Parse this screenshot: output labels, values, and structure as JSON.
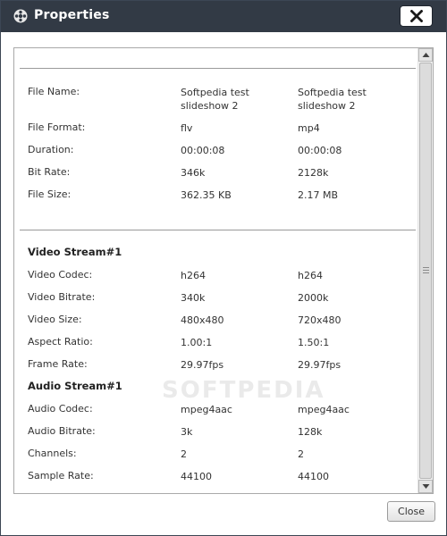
{
  "window": {
    "title": "Properties",
    "title_icon": "film-reel-icon",
    "close_icon": "close-icon",
    "titlebar_color": "#323a45"
  },
  "general": {
    "file_name": {
      "label": "File Name:",
      "v1_line1": "Softpedia test",
      "v1_line2": "slideshow 2",
      "v2_line1": "Softpedia test",
      "v2_line2": "slideshow 2"
    },
    "file_format": {
      "label": "File Format:",
      "v1": "flv",
      "v2": "mp4"
    },
    "duration": {
      "label": "Duration:",
      "v1": "00:00:08",
      "v2": "00:00:08"
    },
    "bit_rate": {
      "label": "Bit Rate:",
      "v1": "346k",
      "v2": "2128k"
    },
    "file_size": {
      "label": "File Size:",
      "v1": "362.35 KB",
      "v2": "2.17 MB"
    }
  },
  "video": {
    "header": "Video Stream#1",
    "codec": {
      "label": "Video Codec:",
      "v1": "h264",
      "v2": "h264"
    },
    "bitrate": {
      "label": "Video Bitrate:",
      "v1": "340k",
      "v2": "2000k"
    },
    "size": {
      "label": "Video Size:",
      "v1": "480x480",
      "v2": "720x480"
    },
    "aspect": {
      "label": "Aspect Ratio:",
      "v1": "1.00:1",
      "v2": "1.50:1"
    },
    "frame_rate": {
      "label": "Frame Rate:",
      "v1": "29.97fps",
      "v2": "29.97fps"
    }
  },
  "audio": {
    "header": "Audio Stream#1",
    "codec": {
      "label": "Audio Codec:",
      "v1": "mpeg4aac",
      "v2": "mpeg4aac"
    },
    "bitrate": {
      "label": "Audio Bitrate:",
      "v1": "3k",
      "v2": "128k"
    },
    "channels": {
      "label": "Channels:",
      "v1": "2",
      "v2": "2"
    },
    "sample_rate": {
      "label": "Sample Rate:",
      "v1": "44100",
      "v2": "44100"
    }
  },
  "watermark": "SOFTPEDIA",
  "footer": {
    "close_label": "Close"
  }
}
